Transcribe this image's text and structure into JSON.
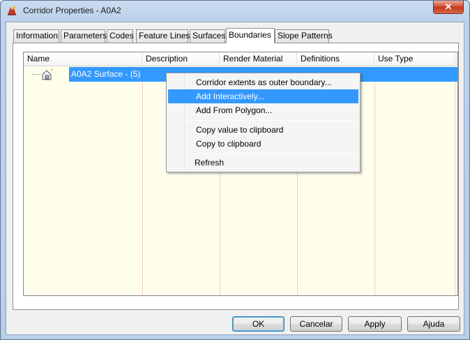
{
  "window": {
    "title": "Corridor Properties - A0A2",
    "close_glyph": "✕",
    "icon": "civil3d-app-icon"
  },
  "tabs": [
    {
      "label": "Information"
    },
    {
      "label": "Parameters"
    },
    {
      "label": "Codes"
    },
    {
      "label": "Feature Lines"
    },
    {
      "label": "Surfaces"
    },
    {
      "label": "Boundaries",
      "active": true
    },
    {
      "label": "Slope Patterns"
    }
  ],
  "list": {
    "columns": [
      {
        "label": "Name"
      },
      {
        "label": "Description"
      },
      {
        "label": "Render Material"
      },
      {
        "label": "Definitions"
      },
      {
        "label": "Use Type"
      }
    ],
    "rows": [
      {
        "name": "A0A2 Surface - (5)",
        "icon": "corridor-surface-icon",
        "selected": true
      }
    ]
  },
  "context_menu": {
    "items": [
      {
        "label": "Corridor extents as outer boundary..."
      },
      {
        "label": "Add Interactively...",
        "highlighted": true
      },
      {
        "label": "Add From Polygon..."
      },
      {
        "label": "Copy value to clipboard"
      },
      {
        "label": "Copy to clipboard"
      },
      {
        "label": "Refresh"
      }
    ]
  },
  "buttons": {
    "ok": "OK",
    "cancel": "Cancelar",
    "apply": "Apply",
    "help": "Ajuda"
  },
  "colors": {
    "selection": "#3399ff",
    "list_background": "#fffeed",
    "close_button": "#c3371c"
  }
}
